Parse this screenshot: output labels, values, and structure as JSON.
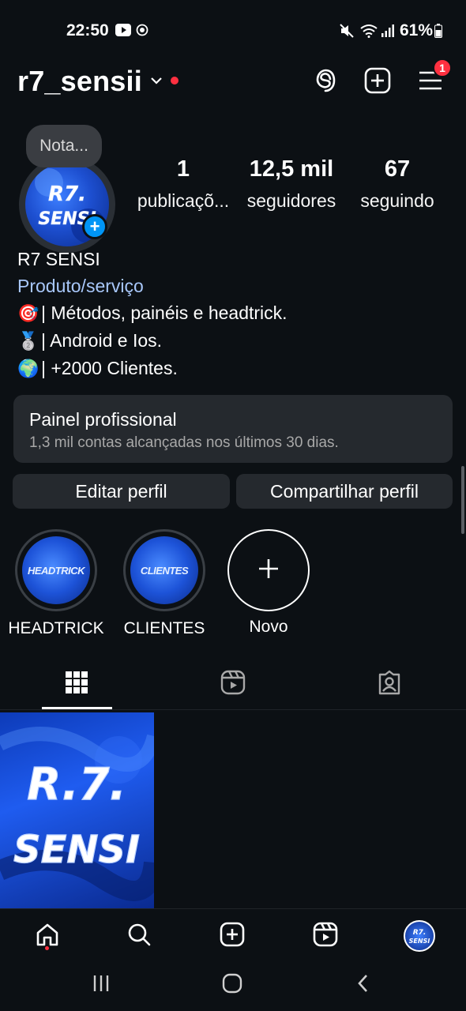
{
  "status_bar": {
    "time": "22:50",
    "battery": "61%"
  },
  "header": {
    "username": "r7_sensii",
    "notification_count": "1"
  },
  "profile": {
    "note": "Nota...",
    "avatar_text": "R7 SENSI",
    "stats": [
      {
        "value": "1",
        "label": "publicaçõ..."
      },
      {
        "value": "12,5 mil",
        "label": "seguidores"
      },
      {
        "value": "67",
        "label": "seguindo"
      }
    ],
    "display_name": "R7 SENSI",
    "category": "Produto/serviço",
    "bio": [
      {
        "emoji": "🎯",
        "text": "| Métodos, painéis e headtrick."
      },
      {
        "emoji": "🥈",
        "text": "| Android e Ios."
      },
      {
        "emoji": "🌍",
        "text": "| +2000 Clientes."
      }
    ]
  },
  "dashboard": {
    "title": "Painel profissional",
    "subtitle": "1,3 mil contas alcançadas nos últimos 30 dias."
  },
  "buttons": {
    "edit": "Editar perfil",
    "share": "Compartilhar perfil"
  },
  "highlights": [
    {
      "label": "HEADTRICK",
      "cover_text": "HEADTRICK"
    },
    {
      "label": "CLIENTES",
      "cover_text": "CLIENTES"
    },
    {
      "label": "Novo"
    }
  ],
  "post": {
    "text_line1": "R.7.",
    "text_line2": "SENSI"
  },
  "colors": {
    "background": "#0c1014",
    "accent_blue": "#0095f6",
    "link": "#a8c7fa",
    "badge_red": "#ff3040"
  }
}
